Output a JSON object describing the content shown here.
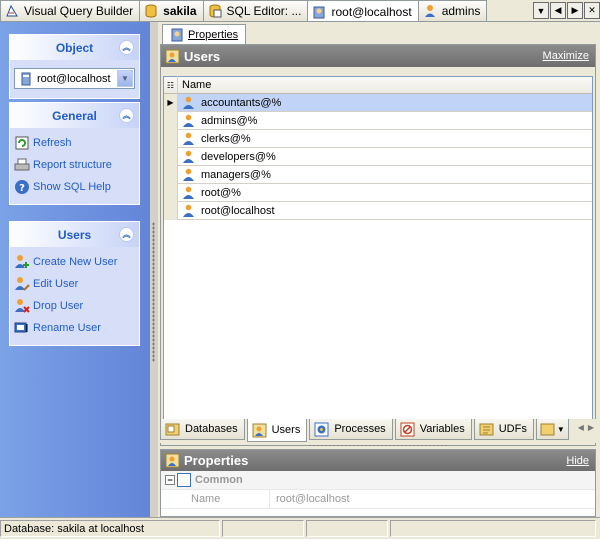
{
  "top_tabs": [
    {
      "label": "Visual Query Builder",
      "icon": "query-builder-icon",
      "active": false,
      "bold": false
    },
    {
      "label": "sakila",
      "icon": "database-icon",
      "active": false,
      "bold": true
    },
    {
      "label": "SQL Editor: ...",
      "icon": "sql-editor-icon",
      "active": false,
      "bold": false
    },
    {
      "label": "root@localhost",
      "icon": "user-icon",
      "active": true,
      "bold": false
    },
    {
      "label": "admins",
      "icon": "user-icon",
      "active": false,
      "bold": false
    }
  ],
  "nav_buttons": [
    "▼",
    "◀",
    "▶",
    "✕"
  ],
  "left_panel": {
    "object": {
      "title": "Object",
      "selected": "root@localhost"
    },
    "general": {
      "title": "General",
      "items": [
        {
          "label": "Refresh",
          "icon": "refresh-icon"
        },
        {
          "label": "Report structure",
          "icon": "printer-icon"
        },
        {
          "label": "Show SQL Help",
          "icon": "help-icon"
        }
      ]
    },
    "users": {
      "title": "Users",
      "items": [
        {
          "label": "Create New User",
          "icon": "add-user-icon"
        },
        {
          "label": "Edit User",
          "icon": "edit-user-icon"
        },
        {
          "label": "Drop User",
          "icon": "drop-user-icon"
        },
        {
          "label": "Rename User",
          "icon": "rename-user-icon"
        }
      ]
    }
  },
  "main": {
    "properties_tab": "Properties",
    "users_panel": {
      "title": "Users",
      "maximize": "Maximize"
    },
    "grid": {
      "column": "Name",
      "rows": [
        "accountants@%",
        "admins@%",
        "clerks@%",
        "developers@%",
        "managers@%",
        "root@%",
        "root@localhost"
      ],
      "selected_index": 0
    },
    "bottom_tabs": [
      {
        "label": "Databases",
        "icon": "databases-icon",
        "active": false
      },
      {
        "label": "Users",
        "icon": "users-icon",
        "active": true
      },
      {
        "label": "Processes",
        "icon": "processes-icon",
        "active": false
      },
      {
        "label": "Variables",
        "icon": "variables-icon",
        "active": false
      },
      {
        "label": "UDFs",
        "icon": "udfs-icon",
        "active": false
      }
    ],
    "properties_panel": {
      "title": "Properties",
      "hide": "Hide",
      "category": "Common",
      "rows": [
        {
          "name": "Name",
          "value": "root@localhost"
        }
      ]
    }
  },
  "status_bar": {
    "text": "Database: sakila at localhost"
  },
  "colors": {
    "accent": "#215dc6",
    "left_panel_bg": "#6485d8",
    "selected_row": "#c1d3f6",
    "header_gray": "#7a7a7a"
  }
}
